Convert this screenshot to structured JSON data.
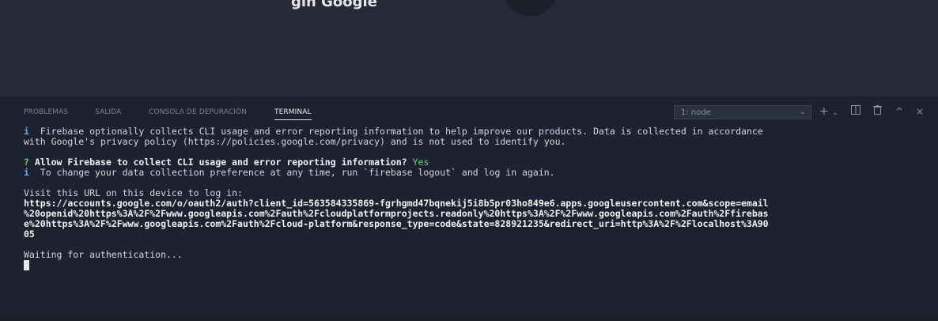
{
  "top": {
    "title": "gin Google"
  },
  "tabs": [
    {
      "label": "PROBLEMAS"
    },
    {
      "label": "SALIDA"
    },
    {
      "label": "CONSOLA DE DEPURACIÓN"
    },
    {
      "label": "TERMINAL"
    }
  ],
  "terminal_selector": {
    "value": "1: node"
  },
  "icons": {
    "plus": "plus-icon",
    "split": "split-terminal-icon",
    "trash": "trash-icon",
    "maximize": "chevron-up-icon",
    "close": "close-icon"
  },
  "terminal": {
    "info_symbol": "i",
    "q_symbol": "?",
    "line1": "  Firebase optionally collects CLI usage and error reporting information to help improve our products. Data is collected in accordance",
    "line2": "with Google's privacy policy (https://policies.google.com/privacy) and is not used to identify you.",
    "question": " Allow Firebase to collect CLI usage and error reporting information?",
    "answer": " Yes",
    "line4": "  To change your data collection preference at any time, run `firebase logout` and log in again.",
    "visit": "Visit this URL on this device to log in:",
    "url1": "https://accounts.google.com/o/oauth2/auth?client_id=563584335869-fgrhgmd47bqnekij5i8b5pr03ho849e6.apps.googleusercontent.com&scope=email",
    "url2": "%20openid%20https%3A%2F%2Fwww.googleapis.com%2Fauth%2Fcloudplatformprojects.readonly%20https%3A%2F%2Fwww.googleapis.com%2Fauth%2Ffirebas",
    "url3": "e%20https%3A%2F%2Fwww.googleapis.com%2Fauth%2Fcloud-platform&response_type=code&state=828921235&redirect_uri=http%3A%2F%2Flocalhost%3A90",
    "url4": "05",
    "waiting": "Waiting for authentication..."
  }
}
